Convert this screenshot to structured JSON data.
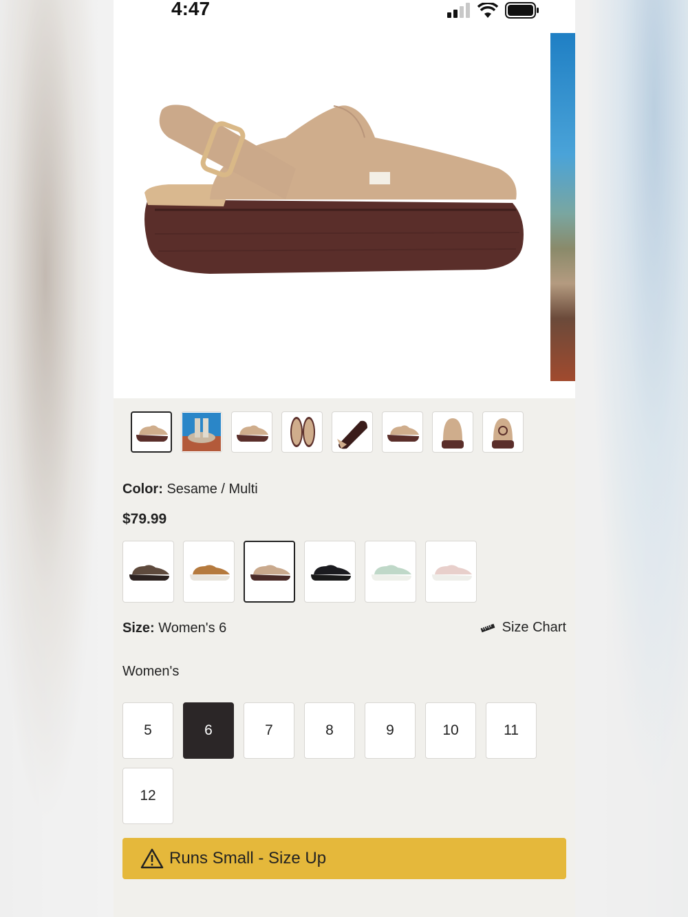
{
  "status_bar": {
    "time": "4:47"
  },
  "gallery": {
    "thumbnails": [
      "shoe-side",
      "lifestyle-photo",
      "shoe-angle",
      "shoe-top-pair",
      "shoe-sole",
      "shoe-side-alt",
      "shoe-front",
      "shoe-back"
    ],
    "selected_index": 0
  },
  "product": {
    "color_label": "Color:",
    "color_value": "Sesame / Multi",
    "price": "$79.99",
    "swatch_colors": [
      "#5e4a3d",
      "#b57a3e",
      "#c9a98d",
      "#1b1b1f",
      "#bfd8c8",
      "#e8cfcb"
    ],
    "swatch_sole_colors": [
      "#2c2220",
      "#e8e4dc",
      "#4a2b28",
      "#1a1a1a",
      "#eef0ea",
      "#eeeeea"
    ],
    "selected_swatch": 2
  },
  "size": {
    "label": "Size:",
    "value": "Women's 6",
    "chart_label": "Size Chart",
    "group_label": "Women's",
    "options": [
      "5",
      "6",
      "7",
      "8",
      "9",
      "10",
      "11",
      "12"
    ],
    "selected": "6"
  },
  "alert": {
    "text": "Runs Small - Size Up",
    "color": "#e5b83b"
  }
}
